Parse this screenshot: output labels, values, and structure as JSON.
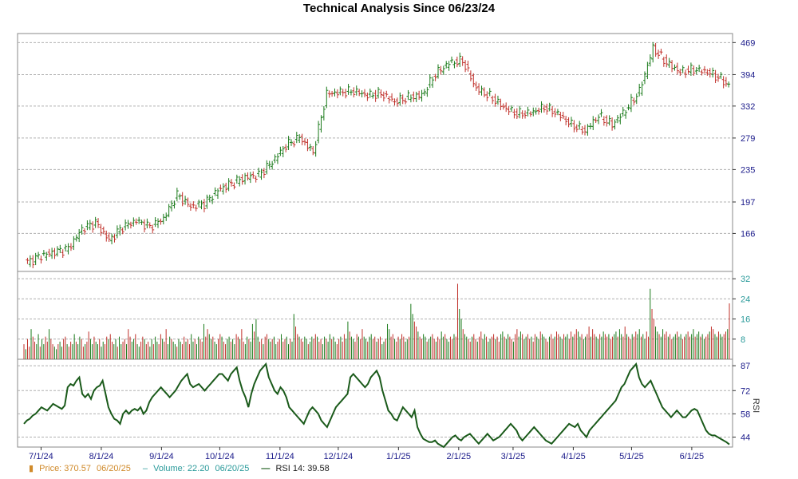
{
  "chart_data": {
    "type": "line",
    "title": "Technical Analysis Since 06/23/24",
    "x_tick_labels": [
      "7/1/24",
      "8/1/24",
      "9/1/24",
      "10/1/24",
      "11/1/24",
      "12/1/24",
      "1/1/25",
      "2/1/25",
      "3/1/25",
      "4/1/25",
      "5/1/25",
      "6/1/25"
    ],
    "panels": {
      "price": {
        "y_scale": "log",
        "ylim": [
          135,
          480
        ],
        "y_ticks": [
          469,
          394,
          332,
          279,
          235,
          197,
          166
        ],
        "series": [
          {
            "name": "Price",
            "type": "ohlc",
            "points": [
              {
                "x": "2024-06-24",
                "y": 142
              },
              {
                "x": "2024-07-01",
                "y": 147
              },
              {
                "x": "2024-07-08",
                "y": 150
              },
              {
                "x": "2024-07-15",
                "y": 153
              },
              {
                "x": "2024-07-22",
                "y": 170
              },
              {
                "x": "2024-07-29",
                "y": 176
              },
              {
                "x": "2024-08-05",
                "y": 160
              },
              {
                "x": "2024-08-12",
                "y": 172
              },
              {
                "x": "2024-08-19",
                "y": 178
              },
              {
                "x": "2024-08-26",
                "y": 172
              },
              {
                "x": "2024-09-02",
                "y": 180
              },
              {
                "x": "2024-09-09",
                "y": 205
              },
              {
                "x": "2024-09-16",
                "y": 192
              },
              {
                "x": "2024-09-23",
                "y": 195
              },
              {
                "x": "2024-09-30",
                "y": 210
              },
              {
                "x": "2024-10-07",
                "y": 218
              },
              {
                "x": "2024-10-14",
                "y": 225
              },
              {
                "x": "2024-10-21",
                "y": 228
              },
              {
                "x": "2024-10-28",
                "y": 245
              },
              {
                "x": "2024-11-04",
                "y": 268
              },
              {
                "x": "2024-11-11",
                "y": 280
              },
              {
                "x": "2024-11-18",
                "y": 258
              },
              {
                "x": "2024-11-25",
                "y": 355
              },
              {
                "x": "2024-12-02",
                "y": 358
              },
              {
                "x": "2024-12-09",
                "y": 360
              },
              {
                "x": "2024-12-16",
                "y": 352
              },
              {
                "x": "2024-12-23",
                "y": 355
              },
              {
                "x": "2024-12-30",
                "y": 340
              },
              {
                "x": "2025-01-06",
                "y": 348
              },
              {
                "x": "2025-01-13",
                "y": 352
              },
              {
                "x": "2025-01-20",
                "y": 395
              },
              {
                "x": "2025-01-27",
                "y": 420
              },
              {
                "x": "2025-02-03",
                "y": 425
              },
              {
                "x": "2025-02-10",
                "y": 365
              },
              {
                "x": "2025-02-17",
                "y": 350
              },
              {
                "x": "2025-02-24",
                "y": 330
              },
              {
                "x": "2025-03-03",
                "y": 318
              },
              {
                "x": "2025-03-10",
                "y": 320
              },
              {
                "x": "2025-03-17",
                "y": 330
              },
              {
                "x": "2025-03-24",
                "y": 318
              },
              {
                "x": "2025-03-31",
                "y": 300
              },
              {
                "x": "2025-04-07",
                "y": 290
              },
              {
                "x": "2025-04-14",
                "y": 315
              },
              {
                "x": "2025-04-21",
                "y": 300
              },
              {
                "x": "2025-04-28",
                "y": 325
              },
              {
                "x": "2025-05-05",
                "y": 360
              },
              {
                "x": "2025-05-12",
                "y": 455
              },
              {
                "x": "2025-05-19",
                "y": 420
              },
              {
                "x": "2025-05-26",
                "y": 400
              },
              {
                "x": "2025-06-02",
                "y": 405
              },
              {
                "x": "2025-06-09",
                "y": 400
              },
              {
                "x": "2025-06-16",
                "y": 385
              },
              {
                "x": "2025-06-20",
                "y": 370.57
              }
            ]
          }
        ]
      },
      "volume": {
        "ylim": [
          0,
          33
        ],
        "y_ticks": [
          32,
          24,
          16,
          8
        ],
        "series": [
          {
            "name": "Volume",
            "type": "bar",
            "values": [
              6,
              4,
              8,
              5,
              12,
              9,
              7,
              6,
              10,
              5,
              8,
              6,
              9,
              7,
              12,
              8,
              6,
              5,
              4,
              6,
              7,
              5,
              8,
              9,
              6,
              5,
              7,
              6,
              10,
              7,
              6,
              9,
              8,
              5,
              6,
              7,
              11,
              8,
              6,
              9,
              7,
              6,
              8,
              5,
              7,
              6,
              9,
              8,
              10,
              7,
              6,
              8,
              5,
              9,
              6,
              7,
              8,
              6,
              12,
              9,
              7,
              8,
              10,
              6,
              5,
              7,
              9,
              8,
              6,
              7,
              5,
              8,
              6,
              9,
              7,
              6,
              10,
              8,
              7,
              12,
              6,
              9,
              8,
              7,
              6,
              5,
              8,
              7,
              6,
              9,
              7,
              8,
              6,
              10,
              7,
              8,
              6,
              9,
              8,
              7,
              14,
              9,
              12,
              10,
              8,
              9,
              7,
              6,
              8,
              10,
              9,
              7,
              6,
              8,
              9,
              7,
              8,
              6,
              10,
              9,
              8,
              12,
              7,
              6,
              9,
              8,
              7,
              14,
              11,
              16,
              9,
              7,
              8,
              6,
              9,
              10,
              8,
              7,
              8,
              9,
              6,
              7,
              8,
              10,
              7,
              8,
              9,
              6,
              8,
              7,
              18,
              13,
              10,
              9,
              8,
              7,
              9,
              8,
              6,
              7,
              9,
              8,
              10,
              9,
              7,
              8,
              6,
              9,
              8,
              7,
              10,
              8,
              9,
              7,
              6,
              8,
              9,
              7,
              10,
              8,
              15,
              11,
              9,
              8,
              7,
              10,
              9,
              8,
              12,
              9,
              8,
              7,
              9,
              10,
              8,
              9,
              7,
              8,
              9,
              6,
              7,
              8,
              14,
              12,
              9,
              10,
              8,
              7,
              9,
              8,
              10,
              9,
              7,
              8,
              9,
              22,
              18,
              15,
              13,
              11,
              9,
              8,
              10,
              9,
              7,
              8,
              9,
              10,
              8,
              7,
              9,
              8,
              11,
              9,
              10,
              8,
              7,
              9,
              8,
              10,
              9,
              30,
              20,
              16,
              12,
              10,
              9,
              8,
              7,
              9,
              10,
              8,
              7,
              9,
              11,
              8,
              10,
              9,
              7,
              8,
              9,
              10,
              8,
              9,
              7,
              10,
              11,
              9,
              8,
              10,
              9,
              8,
              7,
              10,
              12,
              9,
              11,
              10,
              8,
              9,
              10,
              8,
              9,
              7,
              10,
              9,
              8,
              11,
              10,
              9,
              8,
              7,
              9,
              10,
              8,
              9,
              11,
              10,
              9,
              8,
              10,
              9,
              10,
              8,
              11,
              9,
              10,
              12,
              11,
              9,
              10,
              8,
              9,
              10,
              13,
              9,
              12,
              10,
              9,
              8,
              10,
              9,
              11,
              10,
              9,
              10,
              8,
              9,
              10,
              11,
              9,
              12,
              10,
              9,
              13,
              10,
              9,
              8,
              10,
              9,
              11,
              10,
              12,
              9,
              10,
              8,
              11,
              9,
              28,
              20,
              16,
              13,
              11,
              10,
              9,
              12,
              10,
              11,
              9,
              10,
              8,
              9,
              10,
              11,
              9,
              10,
              8,
              9,
              10,
              11,
              9,
              10,
              12,
              9,
              10,
              11,
              9,
              10,
              8,
              9,
              10,
              11,
              13,
              12,
              10,
              9,
              11,
              10,
              9,
              10,
              11,
              12,
              22.2
            ]
          }
        ]
      },
      "rsi": {
        "ylabel": "RSI",
        "ylim": [
          38,
          88
        ],
        "y_ticks": [
          87,
          72,
          58,
          44
        ],
        "series": [
          {
            "name": "RSI 14",
            "type": "line",
            "values": [
              52,
              54,
              55,
              57,
              58,
              60,
              62,
              61,
              60,
              62,
              64,
              63,
              62,
              61,
              63,
              74,
              76,
              75,
              78,
              80,
              70,
              68,
              70,
              67,
              72,
              74,
              75,
              78,
              70,
              62,
              58,
              55,
              54,
              52,
              58,
              60,
              58,
              60,
              61,
              60,
              62,
              58,
              60,
              65,
              68,
              70,
              72,
              74,
              72,
              70,
              68,
              70,
              72,
              75,
              78,
              80,
              82,
              76,
              74,
              75,
              76,
              74,
              72,
              74,
              76,
              78,
              80,
              82,
              82,
              80,
              78,
              82,
              84,
              86,
              78,
              72,
              68,
              62,
              70,
              76,
              80,
              84,
              86,
              88,
              80,
              76,
              72,
              70,
              74,
              72,
              68,
              62,
              60,
              58,
              56,
              54,
              52,
              56,
              60,
              62,
              60,
              58,
              54,
              52,
              50,
              54,
              58,
              62,
              64,
              66,
              68,
              70,
              80,
              82,
              80,
              78,
              76,
              74,
              76,
              80,
              82,
              84,
              80,
              72,
              66,
              60,
              58,
              55,
              54,
              58,
              62,
              60,
              58,
              56,
              60,
              50,
              46,
              43,
              42,
              41,
              41,
              42,
              40,
              39,
              38,
              40,
              42,
              44,
              45,
              43,
              42,
              44,
              45,
              46,
              44,
              42,
              40,
              42,
              44,
              46,
              44,
              42,
              43,
              44,
              46,
              48,
              50,
              52,
              50,
              48,
              44,
              42,
              44,
              46,
              48,
              50,
              48,
              46,
              44,
              42,
              41,
              40,
              42,
              44,
              46,
              48,
              50,
              52,
              51,
              50,
              52,
              48,
              46,
              44,
              48,
              50,
              52,
              54,
              56,
              58,
              60,
              62,
              64,
              66,
              70,
              74,
              76,
              80,
              84,
              86,
              88,
              80,
              76,
              74,
              76,
              78,
              74,
              70,
              66,
              62,
              60,
              58,
              56,
              58,
              60,
              58,
              56,
              56,
              58,
              60,
              61,
              60,
              56,
              52,
              48,
              46,
              45,
              45,
              44,
              43,
              42,
              41,
              39.58
            ]
          }
        ]
      }
    },
    "legend": {
      "price": {
        "label": "Price: 370.57",
        "date": "06/20/25",
        "color": "#d08a2a"
      },
      "volume": {
        "label": "Volume: 22.20",
        "date": "06/20/25",
        "color": "#2a9a9a"
      },
      "rsi": {
        "label": "RSI 14: 39.58",
        "color": "#1a5a1a"
      }
    },
    "colors": {
      "up": "#1a7a1a",
      "down": "#c0302a",
      "grid": "#b0b0b0",
      "rsi": "#1a5a1a",
      "axis": "#1a1a8a"
    },
    "grid": true
  }
}
